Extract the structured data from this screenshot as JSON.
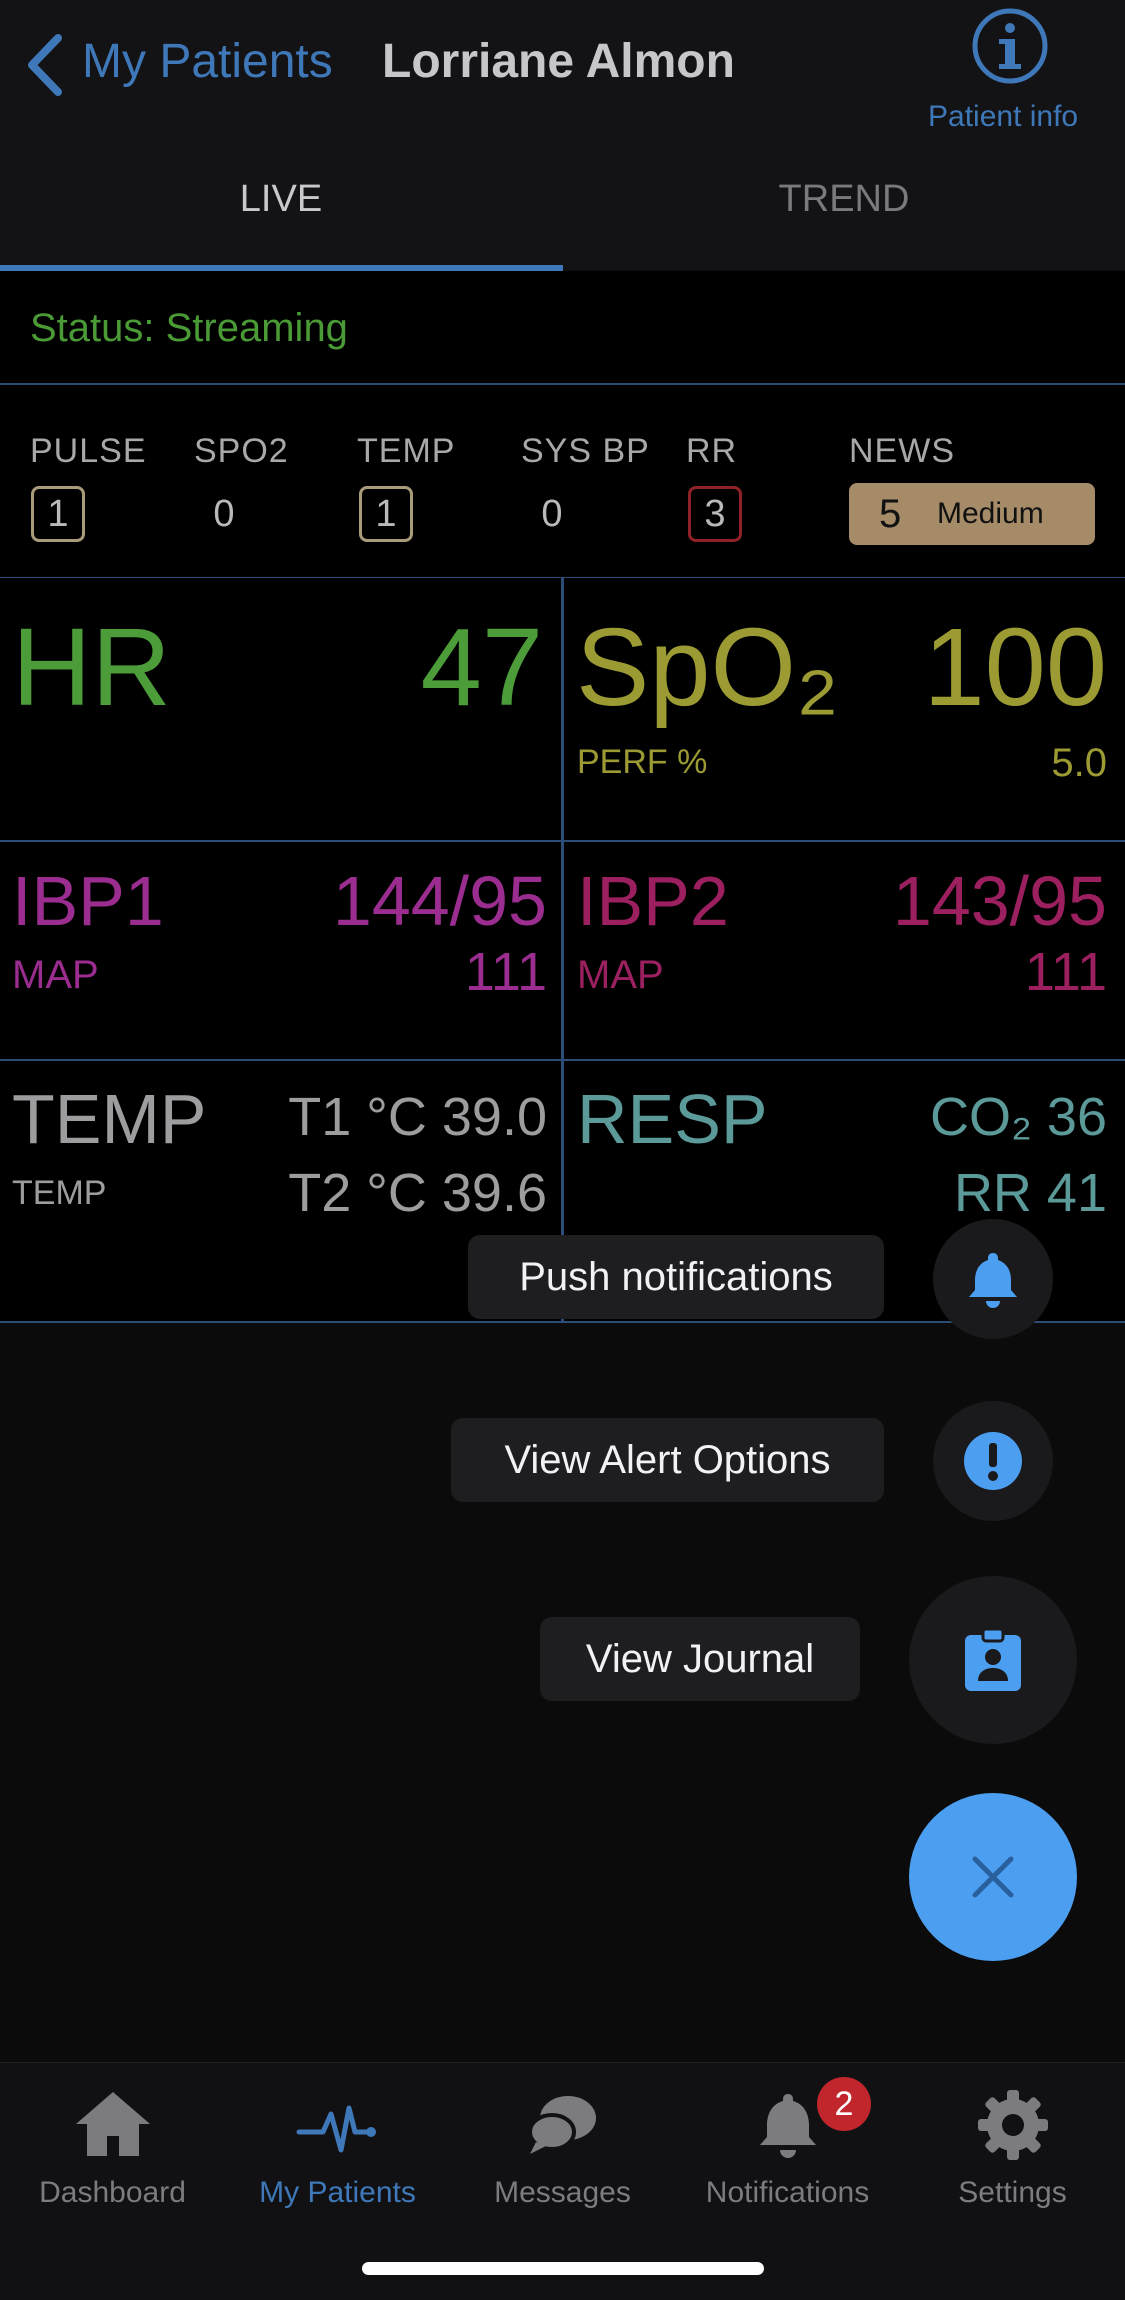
{
  "header": {
    "back_label": "My Patients",
    "patient_name": "Lorriane Almon",
    "info_label": "Patient info"
  },
  "tabs": [
    {
      "label": "LIVE",
      "active": true
    },
    {
      "label": "TREND",
      "active": false
    }
  ],
  "status": {
    "text": "Status: Streaming",
    "color": "#4a9a36"
  },
  "scores": [
    {
      "label": "PULSE",
      "value": "1",
      "boxed": true,
      "box_color": "#a79b79"
    },
    {
      "label": "SPO2",
      "value": "0",
      "boxed": false
    },
    {
      "label": "TEMP",
      "value": "1",
      "boxed": true,
      "box_color": "#a79b79"
    },
    {
      "label": "SYS BP",
      "value": "0",
      "boxed": false
    },
    {
      "label": "RR",
      "value": "3",
      "boxed": true,
      "box_color": "#8e2226"
    },
    {
      "label": "NEWS",
      "value": "5",
      "level": "Medium",
      "pill_color": "#a58b67"
    }
  ],
  "vitals": {
    "hr": {
      "label": "HR",
      "value": "47",
      "color": "#4d9c3a"
    },
    "spo2": {
      "label": "SpO₂",
      "value": "100",
      "sub_label": "PERF %",
      "sub_value": "5.0",
      "color": "#9c9a33"
    },
    "ibp1": {
      "label": "IBP1",
      "value": "144/95",
      "sub_label": "MAP",
      "sub_value": "111",
      "color": "#9a2d8f"
    },
    "ibp2": {
      "label": "IBP2",
      "value": "143/95",
      "sub_label": "MAP",
      "sub_value": "111",
      "color": "#9c2060"
    },
    "temp": {
      "label": "TEMP",
      "sub_label": "TEMP",
      "t1": "T1 °C 39.0",
      "t2": "T2 °C 39.6",
      "color": "#9d9d9f"
    },
    "resp": {
      "label": "RESP",
      "co2": "CO₂ 36",
      "rr": "RR 41",
      "color": "#5c9a9a"
    }
  },
  "menu": {
    "push_notifications": "Push notifications",
    "view_alert_options": "View Alert Options",
    "view_journal": "View Journal",
    "icon_color": "#4c9ff0"
  },
  "tabbar": [
    {
      "label": "Dashboard",
      "icon": "home-icon",
      "active": false
    },
    {
      "label": "My Patients",
      "icon": "pulse-icon",
      "active": true
    },
    {
      "label": "Messages",
      "icon": "chat-icon",
      "active": false
    },
    {
      "label": "Notifications",
      "icon": "bell-icon",
      "active": false,
      "badge": "2"
    },
    {
      "label": "Settings",
      "icon": "gear-icon",
      "active": false
    }
  ]
}
